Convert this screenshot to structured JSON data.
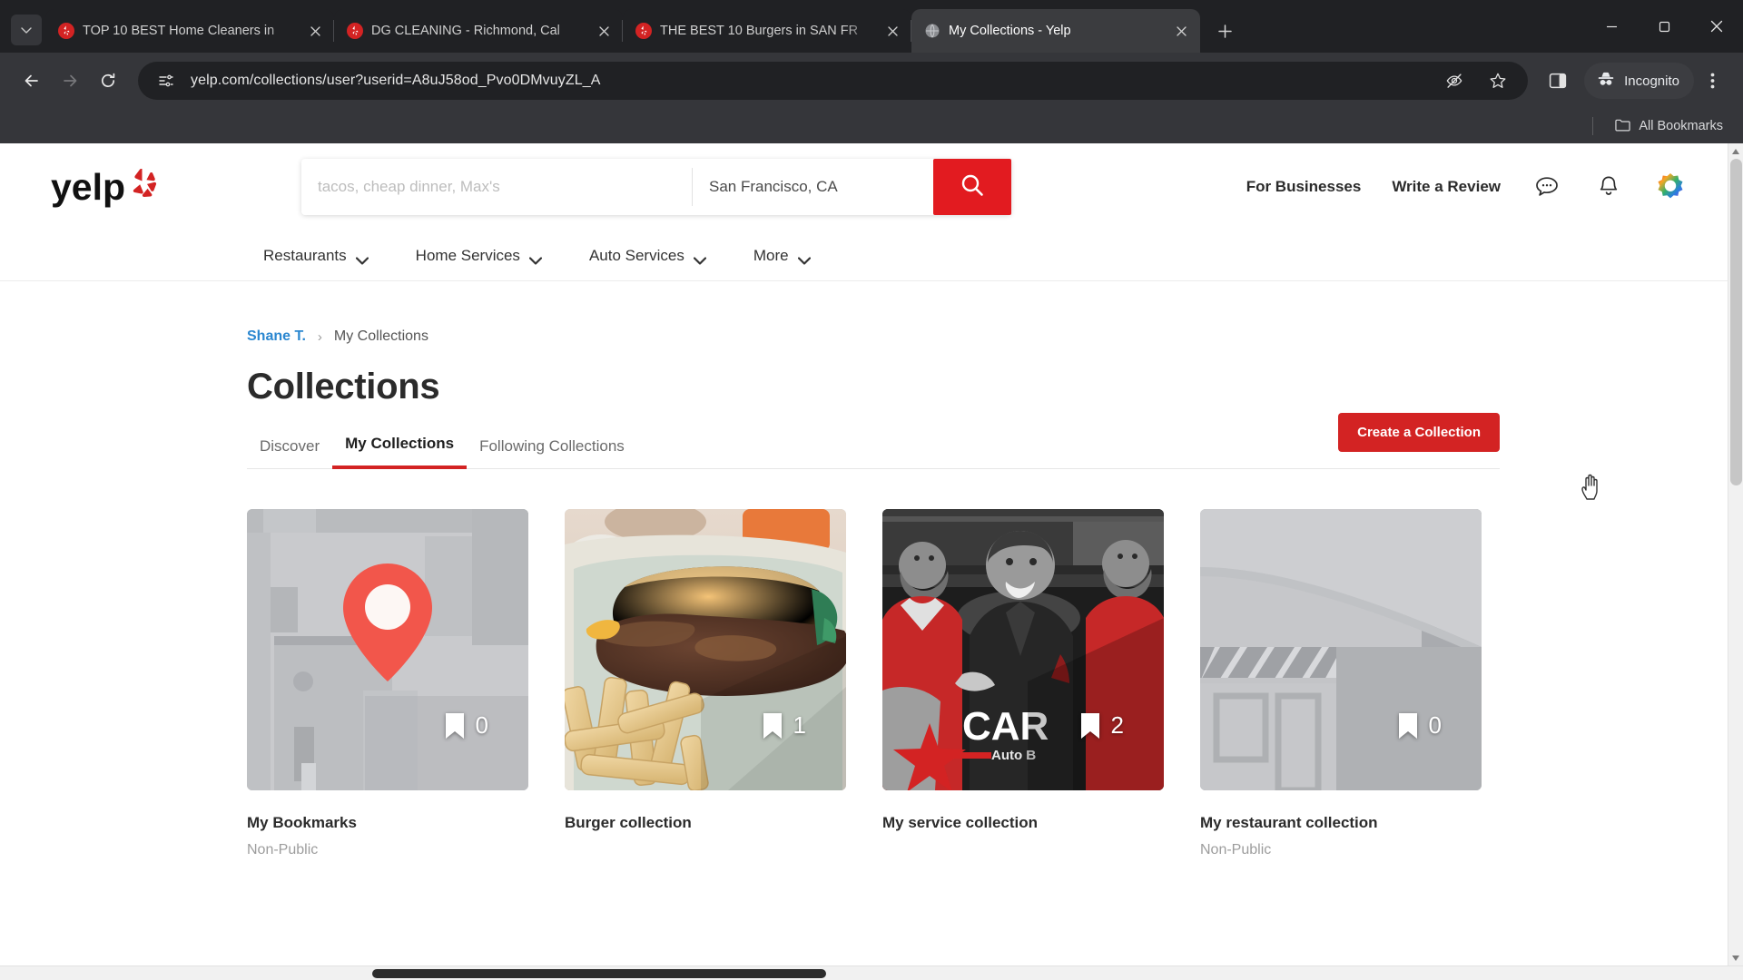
{
  "browser": {
    "tabs": [
      {
        "title": "TOP 10 BEST Home Cleaners in",
        "favicon": "yelp-icon",
        "active": false
      },
      {
        "title": "DG CLEANING - Richmond, Cal",
        "favicon": "yelp-icon",
        "active": false
      },
      {
        "title": "THE BEST 10 Burgers in SAN FR",
        "favicon": "yelp-icon",
        "active": false
      },
      {
        "title": "My Collections - Yelp",
        "favicon": "generic-page-icon",
        "active": true
      }
    ],
    "new_tab_label": "+",
    "tab_search_label": "⌄",
    "window_controls": {
      "minimize": "—",
      "maximize": "☐",
      "close": "✕"
    },
    "nav": {
      "back": "back-arrow-icon",
      "forward": "forward-arrow-icon",
      "reload": "reload-icon"
    },
    "omnibox": {
      "url": "yelp.com/collections/user?userid=A8uJ58od_Pvo0DMvuyZL_A",
      "site_info_icon": "site-settings-icon",
      "actions": [
        "hide-password-icon",
        "bookmark-star-icon"
      ]
    },
    "side_panel_icon": "side-panel-icon",
    "incognito_label": "Incognito",
    "menu_icon": "three-dot-menu-icon",
    "bookmarks": {
      "all_bookmarks_label": "All Bookmarks",
      "folder_icon": "folder-icon"
    }
  },
  "yelp": {
    "logo_text": "yelp",
    "search": {
      "find_placeholder": "tacos, cheap dinner, Max's",
      "find_value": "",
      "location_value": "San Francisco, CA",
      "search_button_icon": "search-icon"
    },
    "header_links": [
      {
        "label": "For Businesses"
      },
      {
        "label": "Write a Review"
      }
    ],
    "header_icons": [
      {
        "name": "messages-icon"
      },
      {
        "name": "notifications-bell-icon"
      },
      {
        "name": "user-avatar"
      }
    ],
    "nav_items": [
      {
        "label": "Restaurants"
      },
      {
        "label": "Home Services"
      },
      {
        "label": "Auto Services"
      },
      {
        "label": "More"
      }
    ],
    "breadcrumb": {
      "user": "Shane T.",
      "separator": "›",
      "current": "My Collections"
    },
    "page_title": "Collections",
    "tabs": [
      {
        "label": "Discover",
        "active": false
      },
      {
        "label": "My Collections",
        "active": true
      },
      {
        "label": "Following Collections",
        "active": false
      }
    ],
    "create_button": "Create a Collection",
    "collections": [
      {
        "title": "My Bookmarks",
        "subtitle": "Non-Public",
        "count": "0",
        "thumb": "map-pin-placeholder"
      },
      {
        "title": "Burger collection",
        "subtitle": "",
        "count": "1",
        "thumb": "burger-photo"
      },
      {
        "title": "My service collection",
        "subtitle": "",
        "count": "2",
        "thumb": "auto-shop-team-photo"
      },
      {
        "title": "My restaurant collection",
        "subtitle": "Non-Public",
        "count": "0",
        "thumb": "storefront-placeholder"
      }
    ]
  },
  "colors": {
    "yelp_red": "#d32323",
    "search_red": "#e21b20",
    "link_blue": "#2b87d0",
    "chrome_dark": "#202124",
    "toolbar_dark": "#35363a"
  }
}
